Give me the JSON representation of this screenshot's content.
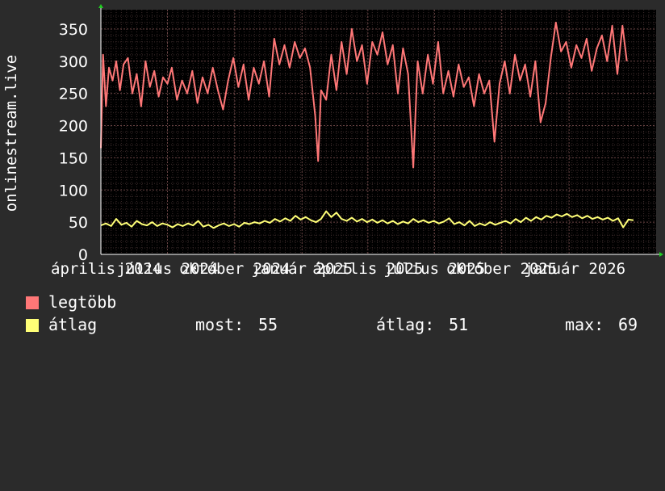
{
  "chart_data": {
    "type": "line",
    "ylabel": "onlinestream.live",
    "ylim": [
      0,
      380
    ],
    "yticks": [
      0,
      50,
      100,
      150,
      200,
      250,
      300,
      350
    ],
    "xlim": [
      "2024-04-01",
      "2026-04-30"
    ],
    "xticks": [
      {
        "date": "2024-04-01",
        "label": "április 2024"
      },
      {
        "date": "2024-07-01",
        "label": "július 2024"
      },
      {
        "date": "2024-10-01",
        "label": "október 2024"
      },
      {
        "date": "2025-01-01",
        "label": "január 2025"
      },
      {
        "date": "2025-04-01",
        "label": "április 2025"
      },
      {
        "date": "2025-07-01",
        "label": "július 2025"
      },
      {
        "date": "2025-10-01",
        "label": "október 2025"
      },
      {
        "date": "2026-01-01",
        "label": "január 2026"
      }
    ],
    "grid": true,
    "series": [
      {
        "name": "legtöbb",
        "color": "#ff7777",
        "points": [
          [
            "2024-04-01",
            165
          ],
          [
            "2024-04-04",
            310
          ],
          [
            "2024-04-08",
            230
          ],
          [
            "2024-04-12",
            290
          ],
          [
            "2024-04-17",
            270
          ],
          [
            "2024-04-22",
            300
          ],
          [
            "2024-04-27",
            255
          ],
          [
            "2024-05-02",
            295
          ],
          [
            "2024-05-08",
            305
          ],
          [
            "2024-05-14",
            250
          ],
          [
            "2024-05-20",
            280
          ],
          [
            "2024-05-26",
            230
          ],
          [
            "2024-06-01",
            300
          ],
          [
            "2024-06-07",
            260
          ],
          [
            "2024-06-13",
            285
          ],
          [
            "2024-06-19",
            245
          ],
          [
            "2024-06-25",
            275
          ],
          [
            "2024-07-01",
            265
          ],
          [
            "2024-07-07",
            290
          ],
          [
            "2024-07-14",
            240
          ],
          [
            "2024-07-21",
            270
          ],
          [
            "2024-07-28",
            250
          ],
          [
            "2024-08-04",
            285
          ],
          [
            "2024-08-11",
            235
          ],
          [
            "2024-08-18",
            275
          ],
          [
            "2024-08-25",
            250
          ],
          [
            "2024-09-01",
            290
          ],
          [
            "2024-09-08",
            255
          ],
          [
            "2024-09-15",
            225
          ],
          [
            "2024-09-22",
            270
          ],
          [
            "2024-09-29",
            305
          ],
          [
            "2024-10-06",
            260
          ],
          [
            "2024-10-13",
            295
          ],
          [
            "2024-10-20",
            240
          ],
          [
            "2024-10-27",
            290
          ],
          [
            "2024-11-03",
            265
          ],
          [
            "2024-11-10",
            300
          ],
          [
            "2024-11-17",
            245
          ],
          [
            "2024-11-24",
            335
          ],
          [
            "2024-12-01",
            295
          ],
          [
            "2024-12-08",
            325
          ],
          [
            "2024-12-15",
            290
          ],
          [
            "2024-12-22",
            330
          ],
          [
            "2024-12-29",
            305
          ],
          [
            "2025-01-05",
            320
          ],
          [
            "2025-01-12",
            290
          ],
          [
            "2025-01-19",
            215
          ],
          [
            "2025-01-23",
            145
          ],
          [
            "2025-01-27",
            255
          ],
          [
            "2025-02-03",
            240
          ],
          [
            "2025-02-10",
            310
          ],
          [
            "2025-02-17",
            255
          ],
          [
            "2025-02-24",
            330
          ],
          [
            "2025-03-03",
            280
          ],
          [
            "2025-03-10",
            350
          ],
          [
            "2025-03-17",
            300
          ],
          [
            "2025-03-24",
            325
          ],
          [
            "2025-03-31",
            265
          ],
          [
            "2025-04-07",
            330
          ],
          [
            "2025-04-14",
            310
          ],
          [
            "2025-04-21",
            345
          ],
          [
            "2025-04-28",
            295
          ],
          [
            "2025-05-05",
            325
          ],
          [
            "2025-05-12",
            250
          ],
          [
            "2025-05-19",
            320
          ],
          [
            "2025-05-26",
            280
          ],
          [
            "2025-06-02",
            135
          ],
          [
            "2025-06-08",
            300
          ],
          [
            "2025-06-15",
            250
          ],
          [
            "2025-06-22",
            310
          ],
          [
            "2025-06-29",
            265
          ],
          [
            "2025-07-06",
            330
          ],
          [
            "2025-07-13",
            250
          ],
          [
            "2025-07-20",
            285
          ],
          [
            "2025-07-27",
            245
          ],
          [
            "2025-08-03",
            295
          ],
          [
            "2025-08-10",
            260
          ],
          [
            "2025-08-17",
            275
          ],
          [
            "2025-08-24",
            230
          ],
          [
            "2025-08-31",
            280
          ],
          [
            "2025-09-07",
            250
          ],
          [
            "2025-09-14",
            270
          ],
          [
            "2025-09-21",
            175
          ],
          [
            "2025-09-28",
            265
          ],
          [
            "2025-10-05",
            300
          ],
          [
            "2025-10-12",
            250
          ],
          [
            "2025-10-19",
            310
          ],
          [
            "2025-10-26",
            270
          ],
          [
            "2025-11-02",
            295
          ],
          [
            "2025-11-09",
            245
          ],
          [
            "2025-11-16",
            300
          ],
          [
            "2025-11-23",
            205
          ],
          [
            "2025-11-30",
            235
          ],
          [
            "2025-12-07",
            305
          ],
          [
            "2025-12-14",
            360
          ],
          [
            "2025-12-21",
            315
          ],
          [
            "2025-12-28",
            330
          ],
          [
            "2026-01-04",
            290
          ],
          [
            "2026-01-11",
            325
          ],
          [
            "2026-01-18",
            305
          ],
          [
            "2026-01-25",
            335
          ],
          [
            "2026-02-01",
            285
          ],
          [
            "2026-02-08",
            320
          ],
          [
            "2026-02-15",
            340
          ],
          [
            "2026-02-22",
            300
          ],
          [
            "2026-03-01",
            355
          ],
          [
            "2026-03-08",
            280
          ],
          [
            "2026-03-15",
            355
          ],
          [
            "2026-03-21",
            300
          ]
        ]
      },
      {
        "name": "átlag",
        "color": "#ffff77",
        "points": [
          [
            "2024-04-01",
            45
          ],
          [
            "2024-04-08",
            48
          ],
          [
            "2024-04-15",
            44
          ],
          [
            "2024-04-22",
            55
          ],
          [
            "2024-04-29",
            46
          ],
          [
            "2024-05-06",
            49
          ],
          [
            "2024-05-13",
            43
          ],
          [
            "2024-05-20",
            52
          ],
          [
            "2024-05-27",
            47
          ],
          [
            "2024-06-03",
            45
          ],
          [
            "2024-06-10",
            50
          ],
          [
            "2024-06-17",
            44
          ],
          [
            "2024-06-24",
            48
          ],
          [
            "2024-07-01",
            46
          ],
          [
            "2024-07-08",
            42
          ],
          [
            "2024-07-15",
            47
          ],
          [
            "2024-07-22",
            44
          ],
          [
            "2024-07-29",
            48
          ],
          [
            "2024-08-05",
            45
          ],
          [
            "2024-08-12",
            52
          ],
          [
            "2024-08-19",
            43
          ],
          [
            "2024-08-26",
            46
          ],
          [
            "2024-09-02",
            41
          ],
          [
            "2024-09-09",
            45
          ],
          [
            "2024-09-16",
            48
          ],
          [
            "2024-09-23",
            44
          ],
          [
            "2024-09-30",
            47
          ],
          [
            "2024-10-07",
            43
          ],
          [
            "2024-10-14",
            49
          ],
          [
            "2024-10-21",
            47
          ],
          [
            "2024-10-28",
            50
          ],
          [
            "2024-11-04",
            48
          ],
          [
            "2024-11-11",
            52
          ],
          [
            "2024-11-18",
            49
          ],
          [
            "2024-11-25",
            55
          ],
          [
            "2024-12-02",
            51
          ],
          [
            "2024-12-09",
            56
          ],
          [
            "2024-12-16",
            52
          ],
          [
            "2024-12-23",
            60
          ],
          [
            "2024-12-30",
            54
          ],
          [
            "2025-01-06",
            58
          ],
          [
            "2025-01-13",
            53
          ],
          [
            "2025-01-20",
            50
          ],
          [
            "2025-01-27",
            55
          ],
          [
            "2025-02-03",
            67
          ],
          [
            "2025-02-10",
            58
          ],
          [
            "2025-02-17",
            65
          ],
          [
            "2025-02-24",
            55
          ],
          [
            "2025-03-03",
            52
          ],
          [
            "2025-03-10",
            57
          ],
          [
            "2025-03-17",
            51
          ],
          [
            "2025-03-24",
            55
          ],
          [
            "2025-03-31",
            50
          ],
          [
            "2025-04-07",
            54
          ],
          [
            "2025-04-14",
            49
          ],
          [
            "2025-04-21",
            53
          ],
          [
            "2025-04-28",
            48
          ],
          [
            "2025-05-05",
            52
          ],
          [
            "2025-05-12",
            47
          ],
          [
            "2025-05-19",
            51
          ],
          [
            "2025-05-26",
            48
          ],
          [
            "2025-06-02",
            55
          ],
          [
            "2025-06-09",
            50
          ],
          [
            "2025-06-16",
            53
          ],
          [
            "2025-06-23",
            49
          ],
          [
            "2025-06-30",
            52
          ],
          [
            "2025-07-07",
            48
          ],
          [
            "2025-07-14",
            51
          ],
          [
            "2025-07-21",
            56
          ],
          [
            "2025-07-28",
            47
          ],
          [
            "2025-08-04",
            50
          ],
          [
            "2025-08-11",
            45
          ],
          [
            "2025-08-18",
            52
          ],
          [
            "2025-08-25",
            44
          ],
          [
            "2025-09-01",
            48
          ],
          [
            "2025-09-08",
            45
          ],
          [
            "2025-09-15",
            50
          ],
          [
            "2025-09-22",
            46
          ],
          [
            "2025-09-29",
            49
          ],
          [
            "2025-10-06",
            52
          ],
          [
            "2025-10-13",
            48
          ],
          [
            "2025-10-20",
            55
          ],
          [
            "2025-10-27",
            50
          ],
          [
            "2025-11-03",
            57
          ],
          [
            "2025-11-10",
            52
          ],
          [
            "2025-11-17",
            58
          ],
          [
            "2025-11-24",
            54
          ],
          [
            "2025-12-01",
            60
          ],
          [
            "2025-12-08",
            57
          ],
          [
            "2025-12-15",
            62
          ],
          [
            "2025-12-22",
            59
          ],
          [
            "2025-12-29",
            63
          ],
          [
            "2026-01-05",
            58
          ],
          [
            "2026-01-12",
            61
          ],
          [
            "2026-01-19",
            56
          ],
          [
            "2026-01-26",
            60
          ],
          [
            "2026-02-02",
            55
          ],
          [
            "2026-02-09",
            58
          ],
          [
            "2026-02-16",
            54
          ],
          [
            "2026-02-23",
            57
          ],
          [
            "2026-03-02",
            52
          ],
          [
            "2026-03-09",
            56
          ],
          [
            "2026-03-16",
            42
          ],
          [
            "2026-03-23",
            54
          ],
          [
            "2026-03-30",
            53
          ]
        ]
      }
    ]
  },
  "legend": {
    "items": [
      {
        "label": "legtöbb",
        "color": "#ff7777"
      },
      {
        "label": "átlag",
        "color": "#ffff77"
      }
    ],
    "stats": {
      "now_label": "most:",
      "now_value": "55",
      "avg_label": "átlag:",
      "avg_value": "51",
      "max_label": "max:",
      "max_value": "69"
    }
  }
}
